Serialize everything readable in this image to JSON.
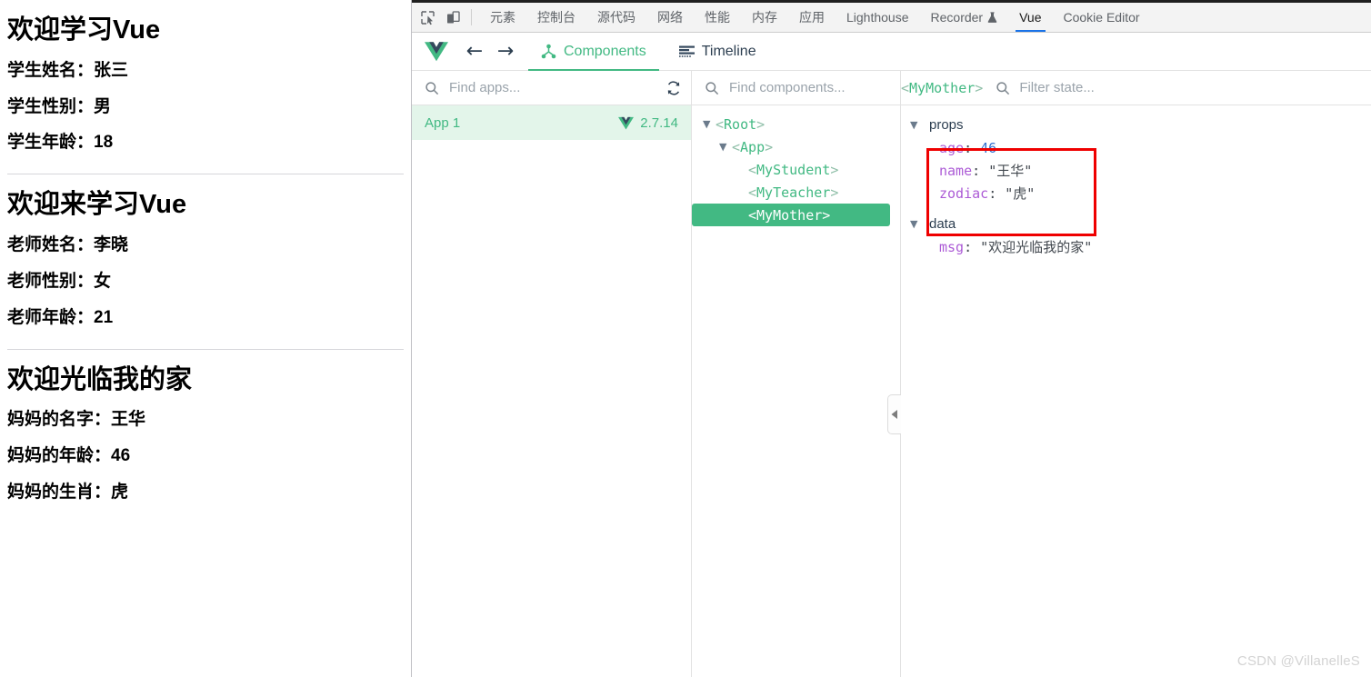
{
  "webpage": {
    "sections": [
      {
        "heading": "欢迎学习Vue",
        "lines": [
          "学生姓名：张三",
          "学生性别：男",
          "学生年龄：18"
        ],
        "divider": true
      },
      {
        "heading": "欢迎来学习Vue",
        "lines": [
          "老师姓名：李晓",
          "老师性别：女",
          "老师年龄：21"
        ],
        "divider": true
      },
      {
        "heading": "欢迎光临我的家",
        "lines": [
          "妈妈的名字：王华",
          "妈妈的年龄：46",
          "妈妈的生肖：虎"
        ],
        "divider": false
      }
    ]
  },
  "devtools": {
    "inspect_icon": "inspect-element-icon",
    "device_icon": "device-toolbar-icon",
    "tabs": [
      {
        "label": "元素",
        "active": false
      },
      {
        "label": "控制台",
        "active": false
      },
      {
        "label": "源代码",
        "active": false
      },
      {
        "label": "网络",
        "active": false
      },
      {
        "label": "性能",
        "active": false
      },
      {
        "label": "内存",
        "active": false
      },
      {
        "label": "应用",
        "active": false
      },
      {
        "label": "Lighthouse",
        "active": false
      },
      {
        "label": "Recorder",
        "active": false,
        "icon": "flask-icon"
      },
      {
        "label": "Vue",
        "active": true
      },
      {
        "label": "Cookie Editor",
        "active": false
      }
    ],
    "active_tab": "Vue",
    "accent_color": "#1a73e8"
  },
  "vue": {
    "logo": "vue-logo-icon",
    "back_icon": "arrow-left-icon",
    "forward_icon": "arrow-right-icon",
    "brand_color": "#42b983",
    "tabs": [
      {
        "label": "Components",
        "icon": "components-tree-icon",
        "active": true
      },
      {
        "label": "Timeline",
        "icon": "timeline-icon",
        "active": false
      }
    ],
    "apps_panel": {
      "search_placeholder": "Find apps...",
      "search_value": "",
      "search_icon": "search-icon",
      "refresh_icon": "refresh-icon",
      "apps": [
        {
          "name": "App 1",
          "version": "2.7.14",
          "selected": true,
          "icon": "vue-logo-icon"
        }
      ]
    },
    "tree_panel": {
      "search_placeholder": "Find components...",
      "search_value": "",
      "search_icon": "search-icon",
      "collapse_icon": "chevron-left-icon",
      "nodes": [
        {
          "label": "Root",
          "indent": 0,
          "caret": "▼",
          "selected": false
        },
        {
          "label": "App",
          "indent": 1,
          "caret": "▼",
          "selected": false
        },
        {
          "label": "MyStudent",
          "indent": 2,
          "caret": "",
          "selected": false
        },
        {
          "label": "MyTeacher",
          "indent": 2,
          "caret": "",
          "selected": false
        },
        {
          "label": "MyMother",
          "indent": 2,
          "caret": "",
          "selected": true
        }
      ]
    },
    "state_panel": {
      "component": "<MyMother>",
      "search_placeholder": "Filter state...",
      "search_value": "",
      "search_icon": "search-icon",
      "groups": [
        {
          "name": "props",
          "caret": "▼",
          "highlighted": true,
          "entries": [
            {
              "key": "age",
              "value": "46",
              "type": "number"
            },
            {
              "key": "name",
              "value": "\"王华\"",
              "type": "string"
            },
            {
              "key": "zodiac",
              "value": "\"虎\"",
              "type": "string"
            }
          ]
        },
        {
          "name": "data",
          "caret": "▼",
          "highlighted": false,
          "entries": [
            {
              "key": "msg",
              "value": "\"欢迎光临我的家\"",
              "type": "string"
            }
          ]
        }
      ],
      "annotation_color": "#ef0000"
    }
  },
  "watermark": "CSDN @VillanelleS"
}
